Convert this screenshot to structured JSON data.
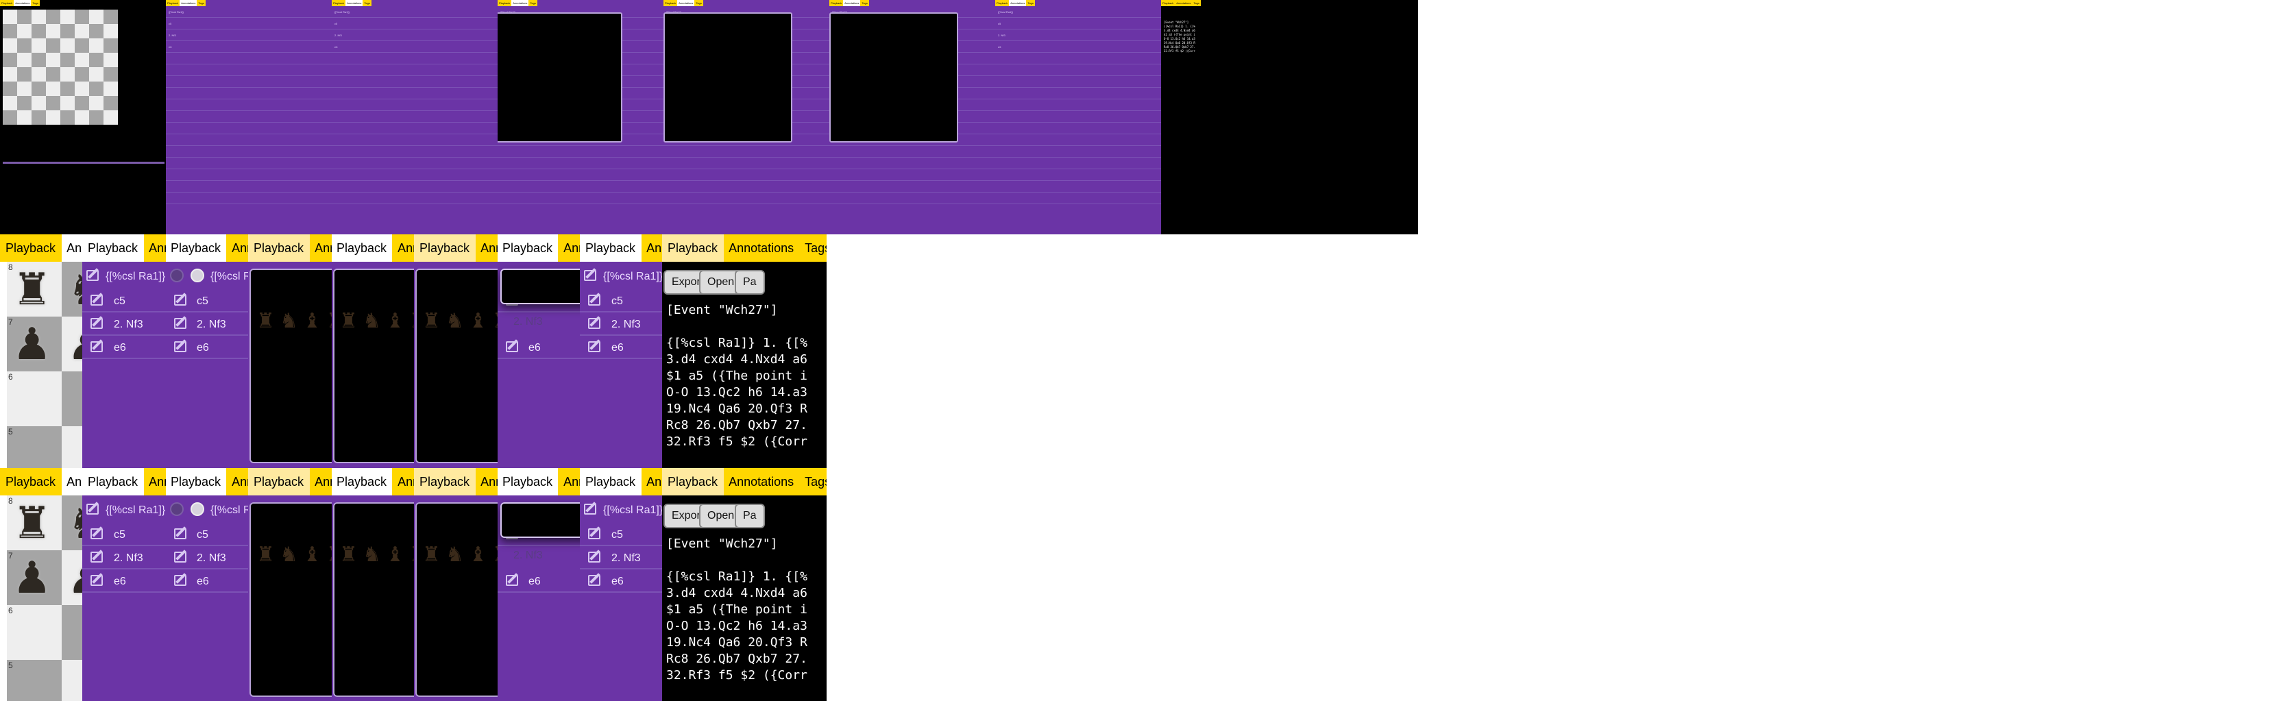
{
  "tabs": [
    "Playback",
    "Annotations",
    "Tags"
  ],
  "toolbar": {
    "lead_text": "{[%csl Ra1]}",
    "move_prefix": "1."
  },
  "moves": [
    "c5",
    "2. Nf3",
    "e6"
  ],
  "board": {
    "rank_labels": [
      "8",
      "7",
      "6",
      "5"
    ],
    "piece_icons": [
      "rook-icon",
      "knight-icon",
      "bishop-icon",
      "pawn-icon"
    ]
  },
  "file_buttons": [
    "Export file",
    "Open file",
    "Pa"
  ],
  "pgn_header": "[Event \"Wch27\"]",
  "pgn_lines": [
    "{[%csl Ra1]} 1. {[%",
    "3.d4 cxd4 4.Nxd4 a6",
    "$1 a5 ({The point i",
    "O-O 13.Qc2 h6 14.a3",
    "19.Nc4 Qa6 20.Qf3 R",
    "Rc8 26.Qb7 Qxb7 27.",
    "32.Rf3 f5 $2 ({Corr"
  ],
  "colors": {
    "tab_yellow": "#ffd700",
    "tab_white": "#ffffff",
    "panel_purple": "#6b34a6",
    "dark": "#000000"
  }
}
